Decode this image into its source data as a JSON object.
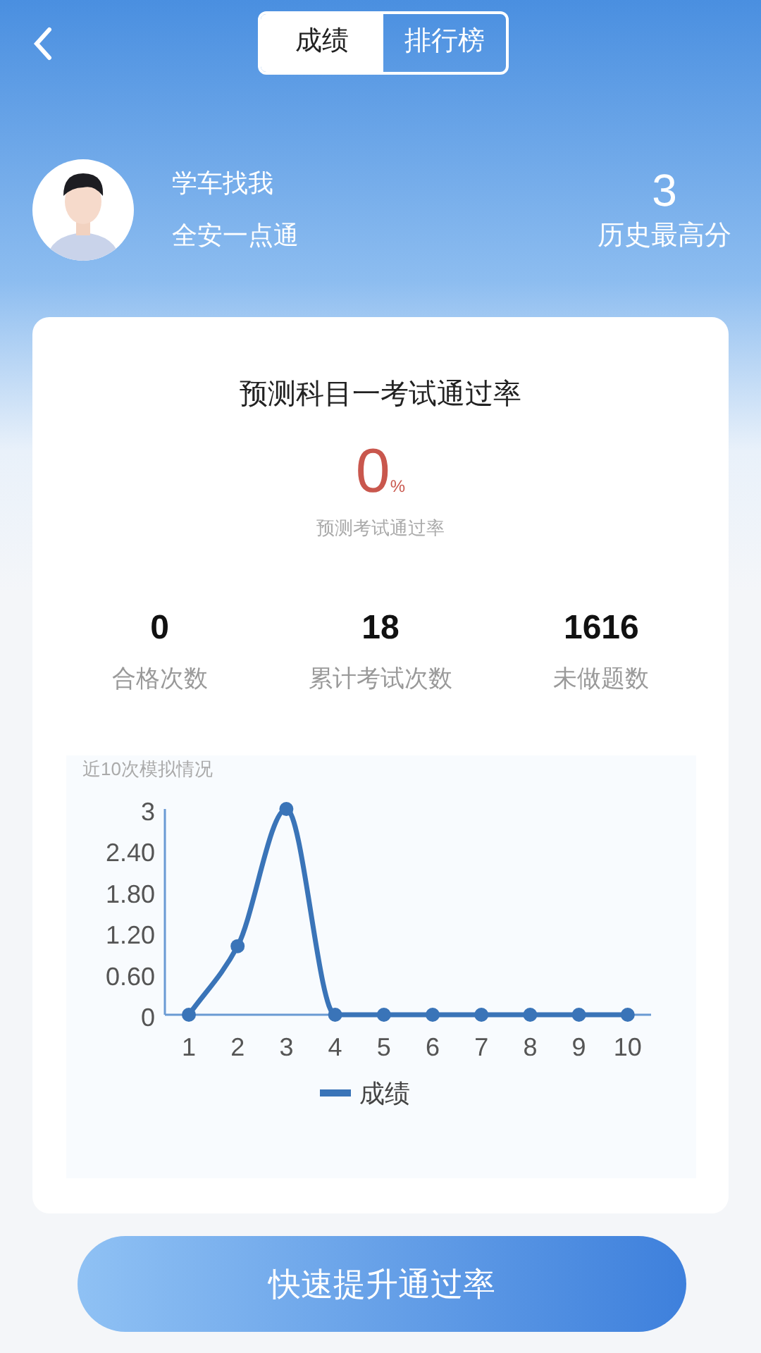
{
  "header": {
    "tabs": [
      {
        "label": "成绩",
        "selected": true
      },
      {
        "label": "排行榜",
        "selected": false
      }
    ]
  },
  "profile": {
    "name": "学车找我",
    "subtitle": "全安一点通",
    "best_score": "3",
    "best_label": "历史最高分"
  },
  "card": {
    "title": "预测科目一考试通过率",
    "rate": "0",
    "rate_unit": "%",
    "rate_label": "预测考试通过率",
    "stats": [
      {
        "value": "0",
        "label": "合格次数"
      },
      {
        "value": "18",
        "label": "累计考试次数"
      },
      {
        "value": "1616",
        "label": "未做题数"
      }
    ],
    "chart_data": {
      "type": "line",
      "title": "近10次模拟情况",
      "categories": [
        "1",
        "2",
        "3",
        "4",
        "5",
        "6",
        "7",
        "8",
        "9",
        "10"
      ],
      "ylim": [
        0,
        3
      ],
      "yticks": [
        0,
        {
          "value": 0.6,
          "label": "0.60"
        },
        {
          "value": 1.2,
          "label": "1.20"
        },
        {
          "value": 1.8,
          "label": "1.80"
        },
        {
          "value": 2.4,
          "label": "2.40"
        },
        3
      ],
      "series": [
        {
          "name": "成绩",
          "color": "#3a74b8",
          "marker": "circle",
          "values": [
            0,
            1,
            3,
            0,
            0,
            0,
            0,
            0,
            0,
            0
          ]
        }
      ]
    }
  },
  "action_button": "快速提升通过率"
}
